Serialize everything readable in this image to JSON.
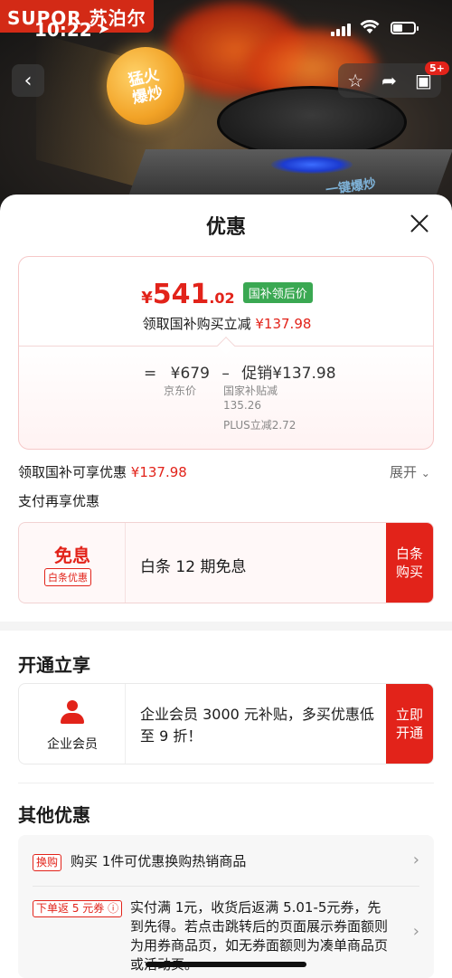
{
  "hero": {
    "brand": "SUPOR 苏泊尔",
    "badge": "猛火\n爆炒",
    "slogan": "一键爆炒",
    "cart_count": "5+"
  },
  "status_bar": {
    "time": "10:22"
  },
  "sheet": {
    "title": "优惠",
    "price": {
      "yen": "¥",
      "integer": "541",
      "decimal": ".02",
      "tag": "国补领后价"
    },
    "subline": {
      "label": "领取国补购买立减",
      "amount": "¥137.98"
    },
    "calc": {
      "equals": "=",
      "jd_price": "¥679",
      "minus": "–",
      "promo": "促销¥137.98"
    },
    "notes": {
      "jd_label": "京东价",
      "gov_sub": "国家补贴减\n135.26",
      "plus": "PLUS立减2.72"
    },
    "gov_offer": {
      "label": "领取国补可享优惠",
      "amount": "¥137.98",
      "expand": "展开"
    },
    "pay_section": "支付再享优惠",
    "baitiao": {
      "big": "免息",
      "tag": "白条优惠",
      "text": "白条 12 期免息",
      "cta": "白条\n购买"
    },
    "open_section": "开通立享",
    "member": {
      "label": "企业会员",
      "text": "企业会员 3000 元补贴，多买优惠低至 9 折！",
      "cta": "立即\n开通"
    },
    "other_section": "其他优惠",
    "other": [
      {
        "tag": "换购",
        "text": "购买 1件可优惠换购热销商品"
      },
      {
        "tag": "下单返 5 元券 ⓘ",
        "text": "实付满 1元，收货后返满 5.01-5元券，先到先得。若点击跳转后的页面展示券面额则为用券商品页，如无券面额则为凑单商品页或活动页。"
      }
    ]
  }
}
